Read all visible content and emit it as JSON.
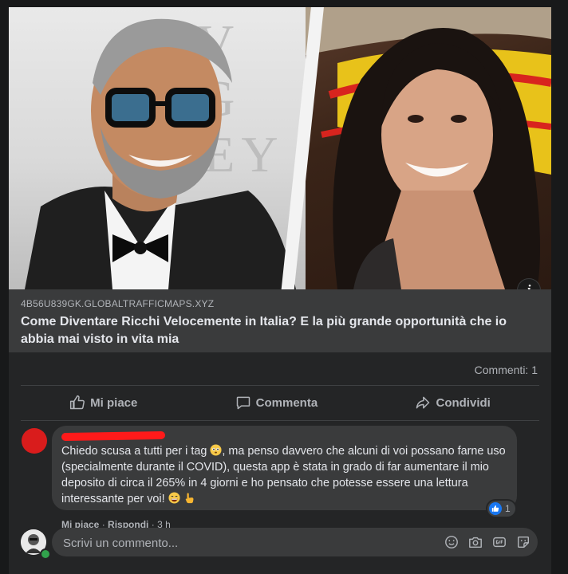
{
  "post": {
    "link": {
      "domain": "4B56U839GK.GLOBALTRAFFICMAPS.XYZ",
      "title": "Come Diventare Ricchi Velocemente in Italia? E la più grande opportunità che io abbia mai visto in vita mia",
      "info_badge": "i"
    },
    "comments_count": "Commenti: 1",
    "actions": [
      {
        "label": "Mi piace",
        "icon": "thumbs-up-icon"
      },
      {
        "label": "Commenta",
        "icon": "comment-icon"
      },
      {
        "label": "Condividi",
        "icon": "share-icon"
      }
    ]
  },
  "comment": {
    "text_before_emoji": "Chiedo scusa a tutti per i tag",
    "text_after_emoji": ", ma penso davvero che alcuni di voi possano farne uso (specialmente durante il COVID), questa app è stata in grado di far aumentare il mio deposito di circa il 265% in 4 giorni e ho pensato che potesse essere una lettura interessante per voi!",
    "reaction_count": "1",
    "meta": {
      "like": "Mi piace",
      "reply": "Rispondi",
      "time": "3 h"
    }
  },
  "composer": {
    "placeholder": "Scrivi un commento..."
  },
  "colors": {
    "background": "#18191a",
    "card": "#242526",
    "bubble": "#3a3b3c",
    "like_blue": "#1877f2"
  }
}
